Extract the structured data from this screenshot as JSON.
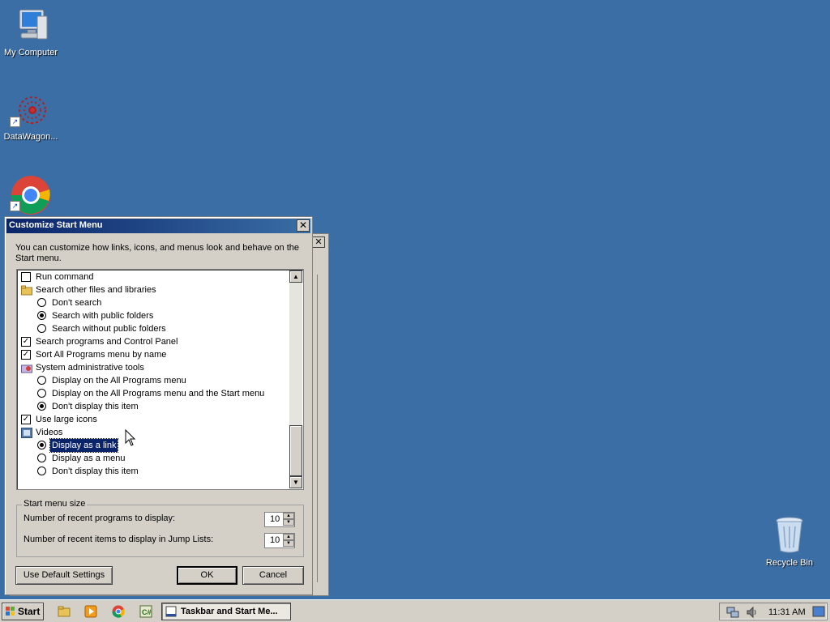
{
  "desktop": {
    "icons": [
      {
        "label": "My Computer",
        "icon": "computer-icon"
      },
      {
        "label": "DataWagon...",
        "icon": "datawagon-icon"
      },
      {
        "label": "",
        "icon": "chrome-icon"
      },
      {
        "label": "Recycle Bin",
        "icon": "recycle-bin-icon"
      }
    ]
  },
  "dialog": {
    "title": "Customize Start Menu",
    "description": "You can customize how links, icons, and menus look and behave on the Start menu.",
    "items": [
      {
        "kind": "checkbox",
        "label": "Run command",
        "checked": false,
        "level": 0
      },
      {
        "kind": "folder",
        "label": "Search other files and libraries",
        "level": 0
      },
      {
        "kind": "radio",
        "label": "Don't search",
        "checked": false,
        "level": 1
      },
      {
        "kind": "radio",
        "label": "Search with public folders",
        "checked": true,
        "level": 1
      },
      {
        "kind": "radio",
        "label": "Search without public folders",
        "checked": false,
        "level": 1
      },
      {
        "kind": "checkbox",
        "label": "Search programs and Control Panel",
        "checked": true,
        "level": 0
      },
      {
        "kind": "checkbox",
        "label": "Sort All Programs menu by name",
        "checked": true,
        "level": 0
      },
      {
        "kind": "tools",
        "label": "System administrative tools",
        "level": 0
      },
      {
        "kind": "radio",
        "label": "Display on the All Programs menu",
        "checked": false,
        "level": 1
      },
      {
        "kind": "radio",
        "label": "Display on the All Programs menu and the Start menu",
        "checked": false,
        "level": 1
      },
      {
        "kind": "radio",
        "label": "Don't display this item",
        "checked": true,
        "level": 1
      },
      {
        "kind": "checkbox",
        "label": "Use large icons",
        "checked": true,
        "level": 0
      },
      {
        "kind": "video",
        "label": "Videos",
        "level": 0
      },
      {
        "kind": "radio",
        "label": "Display as a link",
        "checked": true,
        "level": 1,
        "selected": true
      },
      {
        "kind": "radio",
        "label": "Display as a menu",
        "checked": false,
        "level": 1
      },
      {
        "kind": "radio",
        "label": "Don't display this item",
        "checked": false,
        "level": 1
      }
    ],
    "size_group": {
      "legend": "Start menu size",
      "recent_programs_label": "Number of recent programs to display:",
      "recent_programs_value": "10",
      "recent_items_label": "Number of recent items to display in Jump Lists:",
      "recent_items_value": "10"
    },
    "buttons": {
      "defaults": "Use Default Settings",
      "ok": "OK",
      "cancel": "Cancel"
    }
  },
  "taskbar": {
    "start_label": "Start",
    "quick_launch": [
      "explorer-icon",
      "media-player-icon",
      "chrome-icon",
      "csharp-icon"
    ],
    "active_task": "Taskbar and Start Me...",
    "clock": "11:31 AM"
  },
  "colors": {
    "desktop": "#3a6ea5",
    "title_bar": "#0a246a",
    "face": "#d4d0c8"
  }
}
